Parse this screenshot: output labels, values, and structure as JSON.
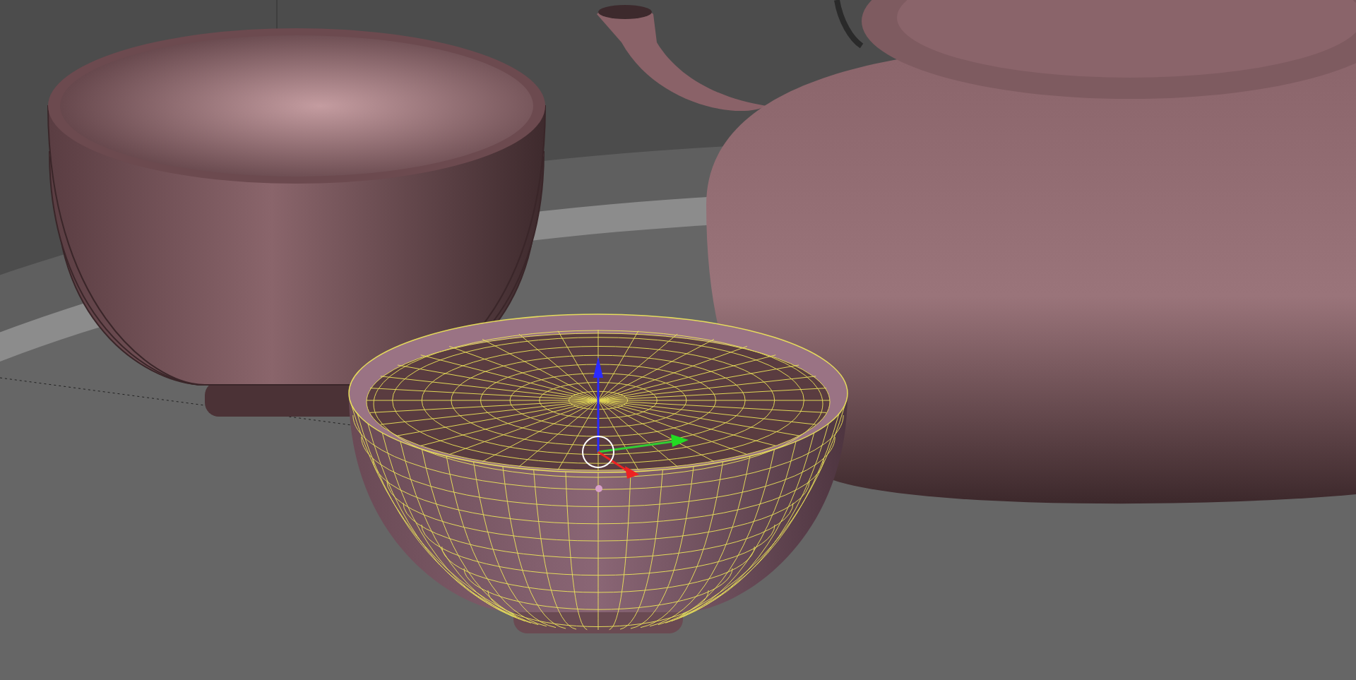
{
  "viewport": {
    "objects": [
      {
        "kind": "bowl_stack",
        "selected": false
      },
      {
        "kind": "teapot",
        "selected": false
      },
      {
        "kind": "bowl",
        "selected": true
      }
    ]
  }
}
